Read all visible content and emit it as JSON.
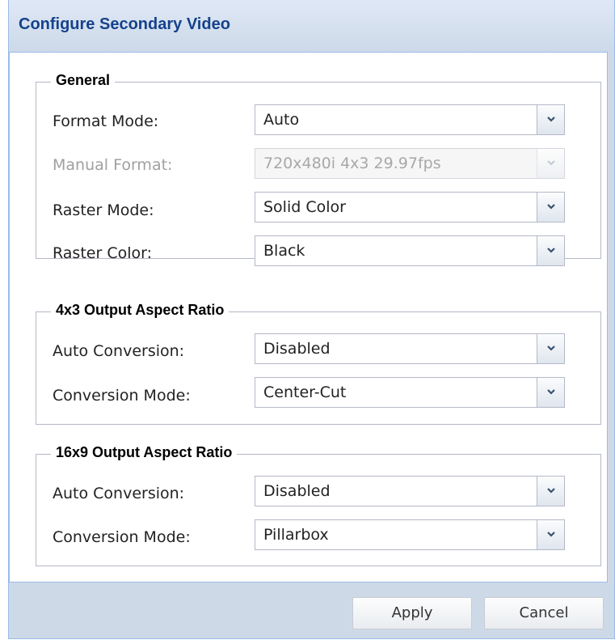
{
  "dialog": {
    "title": "Configure Secondary Video"
  },
  "general": {
    "legend": "General",
    "format_mode": {
      "label": "Format Mode:",
      "value": "Auto"
    },
    "manual_format": {
      "label": "Manual Format:",
      "value": "720x480i 4x3 29.97fps",
      "disabled": true
    },
    "raster_mode": {
      "label": "Raster Mode:",
      "value": "Solid Color"
    },
    "raster_color": {
      "label": "Raster Color:",
      "value": "Black"
    }
  },
  "aspect_4x3": {
    "legend": "4x3 Output Aspect Ratio",
    "auto_conversion": {
      "label": "Auto Conversion:",
      "value": "Disabled"
    },
    "conversion_mode": {
      "label": "Conversion Mode:",
      "value": "Center-Cut"
    }
  },
  "aspect_16x9": {
    "legend": "16x9 Output Aspect Ratio",
    "auto_conversion": {
      "label": "Auto Conversion:",
      "value": "Disabled"
    },
    "conversion_mode": {
      "label": "Conversion Mode:",
      "value": "Pillarbox"
    }
  },
  "buttons": {
    "apply": "Apply",
    "cancel": "Cancel"
  },
  "icons": {
    "dropdown": "chevron-down-icon"
  },
  "colors": {
    "title_text": "#15428b",
    "title_bar": "#dfe8f6",
    "window_frame": "#ced9e7",
    "field_border": "#b5b8c8",
    "disabled_text": "#a0a0a0"
  }
}
